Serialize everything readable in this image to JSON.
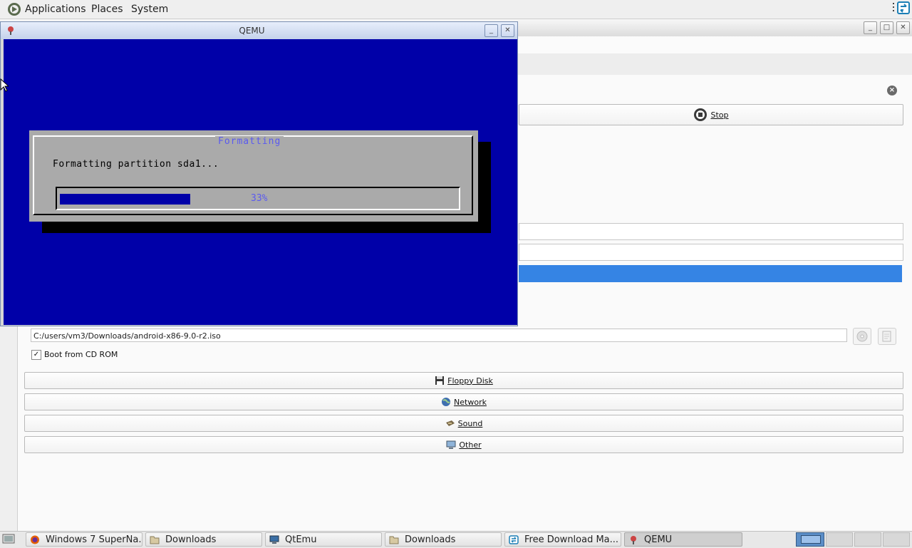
{
  "top_panel": {
    "menus": [
      "Applications",
      "Places",
      "System"
    ]
  },
  "qemu_window": {
    "title": "QEMU",
    "dialog": {
      "title": "Formatting",
      "message": "Formatting partition sda1...",
      "progress_text": "33%",
      "progress_fraction": 0.33
    }
  },
  "qtemu": {
    "stop_label": "Stop",
    "iso_path": "C:/users/vm3/Downloads/android-x86-9.0-r2.iso",
    "boot_from_cd_label": "Boot from CD ROM",
    "boot_from_cd_checked": true,
    "sections": [
      "Floppy Disk",
      "Network",
      "Sound",
      "Other"
    ]
  },
  "taskbar": {
    "items": [
      {
        "label": "Windows 7 SuperNa...",
        "icon": "firefox-icon"
      },
      {
        "label": "Downloads",
        "icon": "folder-icon"
      },
      {
        "label": "QtEmu",
        "icon": "monitor-icon"
      },
      {
        "label": "Downloads",
        "icon": "folder-icon"
      },
      {
        "label": "Free Download Ma...",
        "icon": "download-manager-icon"
      },
      {
        "label": "QEMU",
        "icon": "qemu-icon",
        "active": true
      }
    ]
  },
  "colors": {
    "qemu_screen": "#0000a8",
    "dialog_gray": "#aaaaaa",
    "accent_title": "#5a5af0",
    "selection_blue": "#3584e4"
  }
}
